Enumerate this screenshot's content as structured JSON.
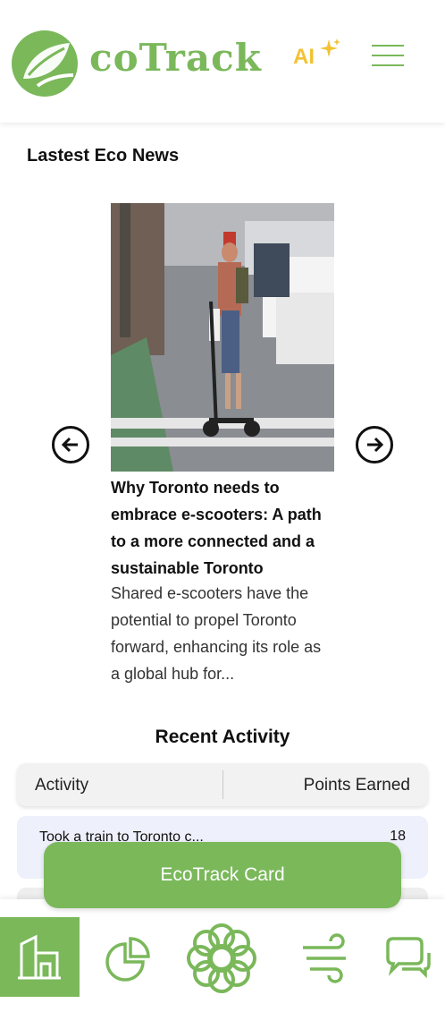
{
  "header": {
    "brand_text": "coTrack",
    "ai_label": "AI",
    "brand_color": "#7ab85a",
    "ai_color": "#f2c233"
  },
  "news": {
    "section_title": "Lastest Eco News",
    "title": "Why Toronto needs to embrace e-scooters: A path to a more connected and a sustainable Toronto",
    "excerpt": "Shared e-scooters have the potential to propel Toronto forward, enhancing its role as a global hub for...",
    "prev_icon": "arrow-left-circle-icon",
    "next_icon": "arrow-right-circle-icon"
  },
  "recent_activity": {
    "title": "Recent Activity",
    "columns": [
      "Activity",
      "Points Earned"
    ],
    "rows": [
      {
        "activity": "Took a train to Toronto c...",
        "points": "18"
      },
      {
        "activity": "",
        "points": ""
      }
    ]
  },
  "card_button": {
    "label": "EcoTrack Card"
  },
  "bottom_nav": {
    "items": [
      {
        "icon": "home-icon",
        "active": true
      },
      {
        "icon": "pie-chart-icon",
        "active": false
      },
      {
        "icon": "flower-icon",
        "active": false
      },
      {
        "icon": "wind-icon",
        "active": false
      },
      {
        "icon": "chat-bubbles-icon",
        "active": false
      }
    ]
  }
}
